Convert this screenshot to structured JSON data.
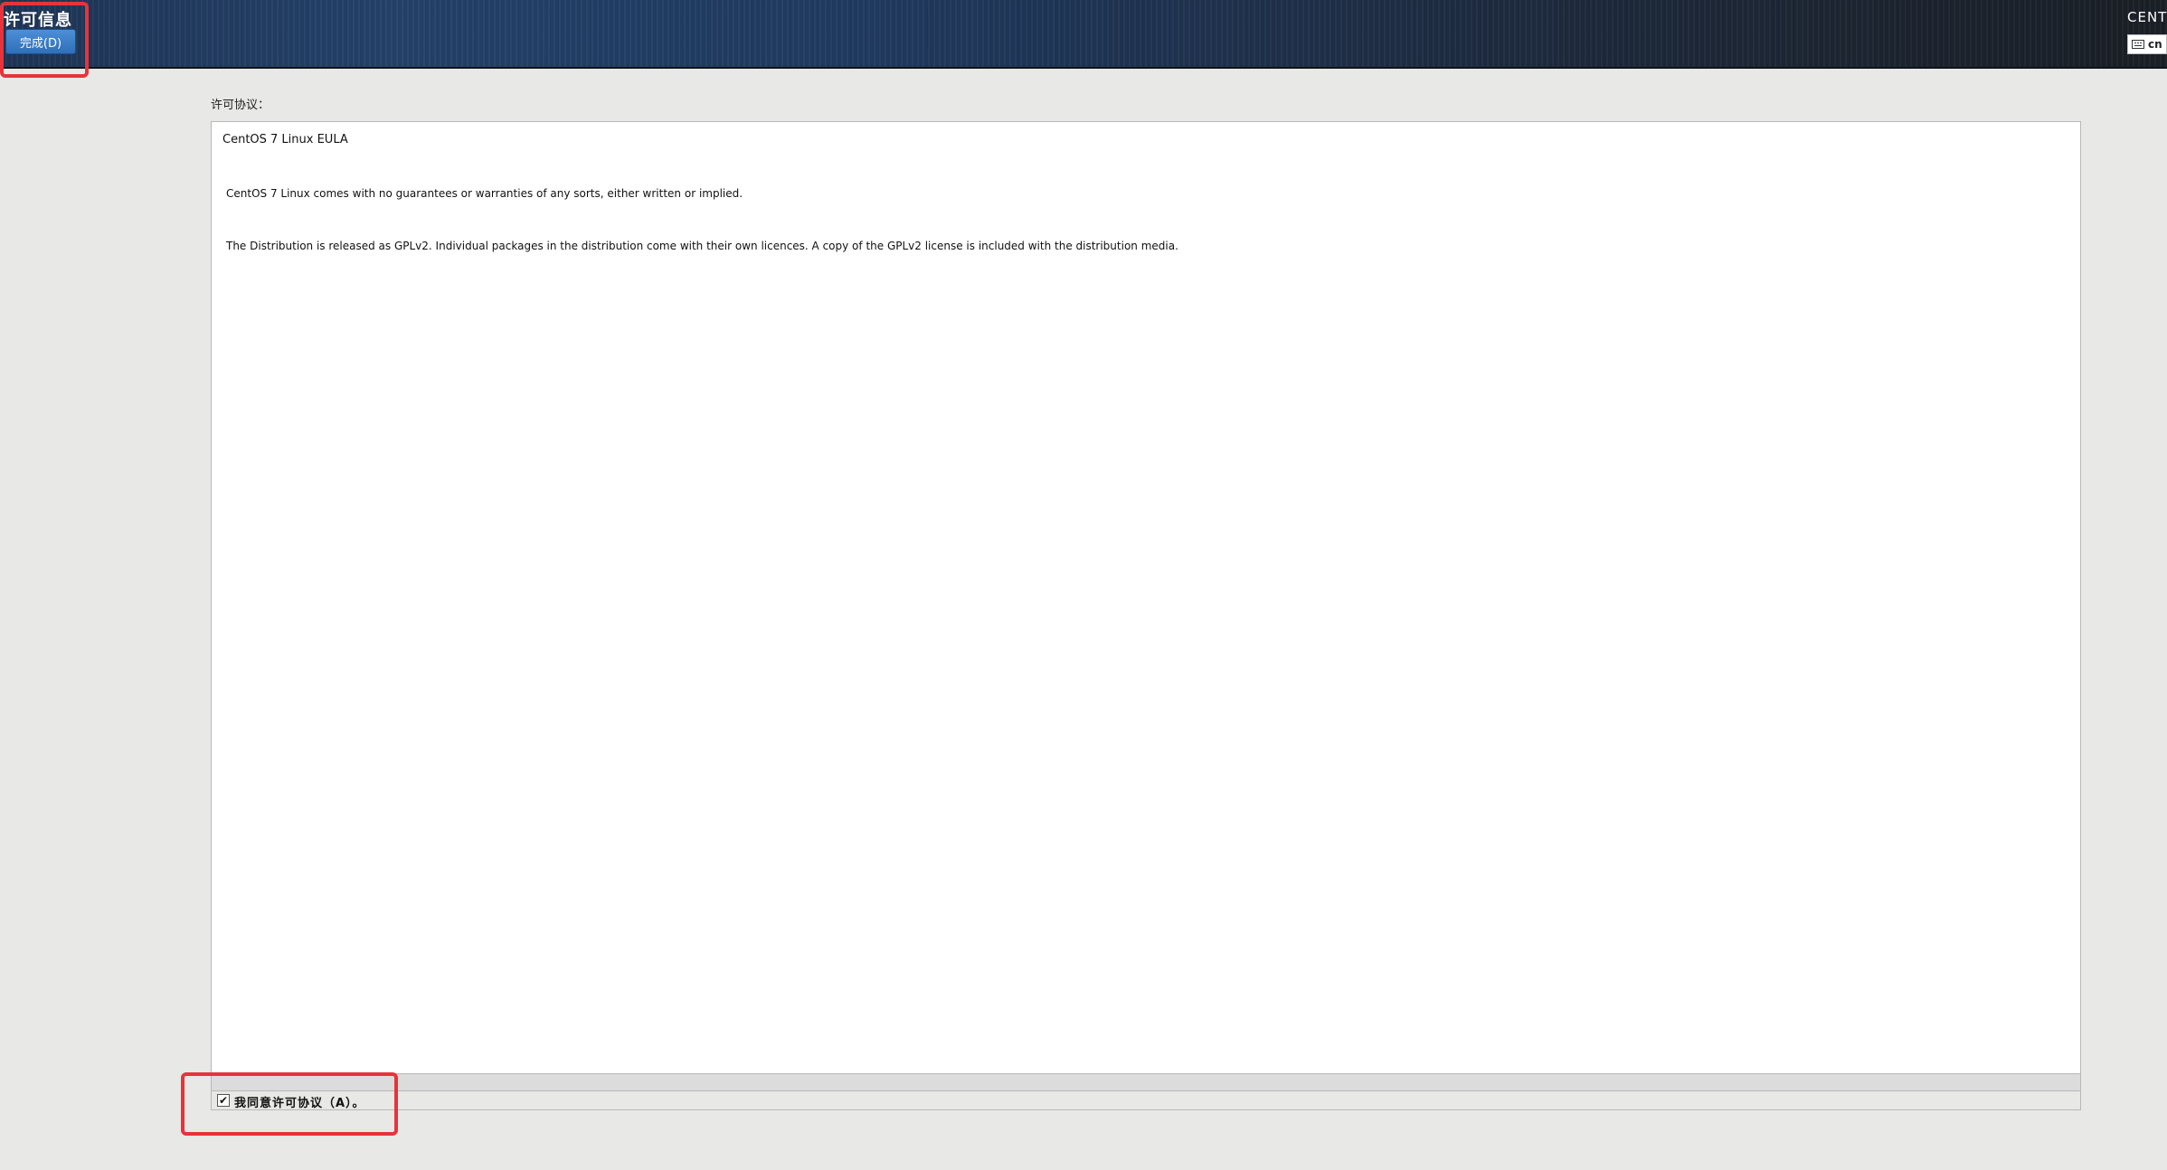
{
  "header": {
    "spoke_title": "许可信息",
    "done_button_label": "完成(D)",
    "product_name": "CENTOS",
    "keyboard_layout": "cn",
    "keyboard_icon": "keyboard-icon"
  },
  "main": {
    "section_label": "许可协议：",
    "eula": {
      "title": "CentOS 7 Linux EULA",
      "paragraphs": [
        "CentOS 7 Linux comes with no guarantees or warranties of any sorts, either written or implied.",
        "The Distribution is released as GPLv2. Individual packages in the distribution come with their own licences. A copy of the GPLv2 license is included with the distribution media."
      ]
    },
    "agree_checkbox": {
      "checked": true,
      "check_glyph": "✔",
      "label": "我同意许可协议（A）。"
    }
  },
  "colors": {
    "annotation_highlight": "#e8333b",
    "done_button": "#3a7bc8",
    "topbar": "#203a60"
  }
}
